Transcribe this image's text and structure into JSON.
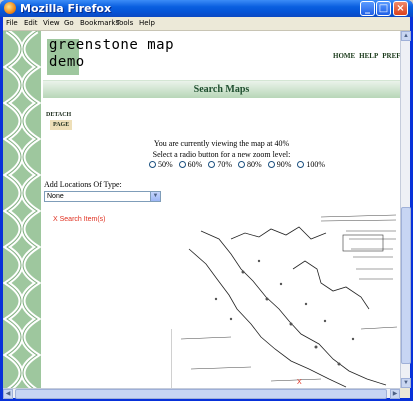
{
  "window": {
    "title": "Mozilla Firefox",
    "min_label": "_",
    "max_label": "□",
    "close_label": "×"
  },
  "menu": [
    "File",
    "Edit",
    "View",
    "Go",
    "Bookmarks",
    "Tools",
    "Help"
  ],
  "page": {
    "logo_line1": "greenstone map",
    "logo_line2": "demo",
    "nav": [
      "HOME",
      "HELP",
      "PREFERENCES"
    ],
    "band_title": "Search Maps",
    "detach_line1": "DETACH",
    "detach_line2": "PAGE",
    "zoom_line1": "You are currently viewing the map at 40%",
    "zoom_line2": "Select a radio button for a new zoom level:",
    "zoom_options": [
      "50%",
      "60%",
      "70%",
      "80%",
      "90%",
      "100%"
    ],
    "add_label": "Add Locations Of Type:",
    "select_value": "None",
    "search_items": "X Search Item(s)",
    "map_marker": "X"
  },
  "colors": {
    "accent_green": "#9ec79e",
    "band_text": "#1f4f2f",
    "search_red": "#e03020"
  }
}
